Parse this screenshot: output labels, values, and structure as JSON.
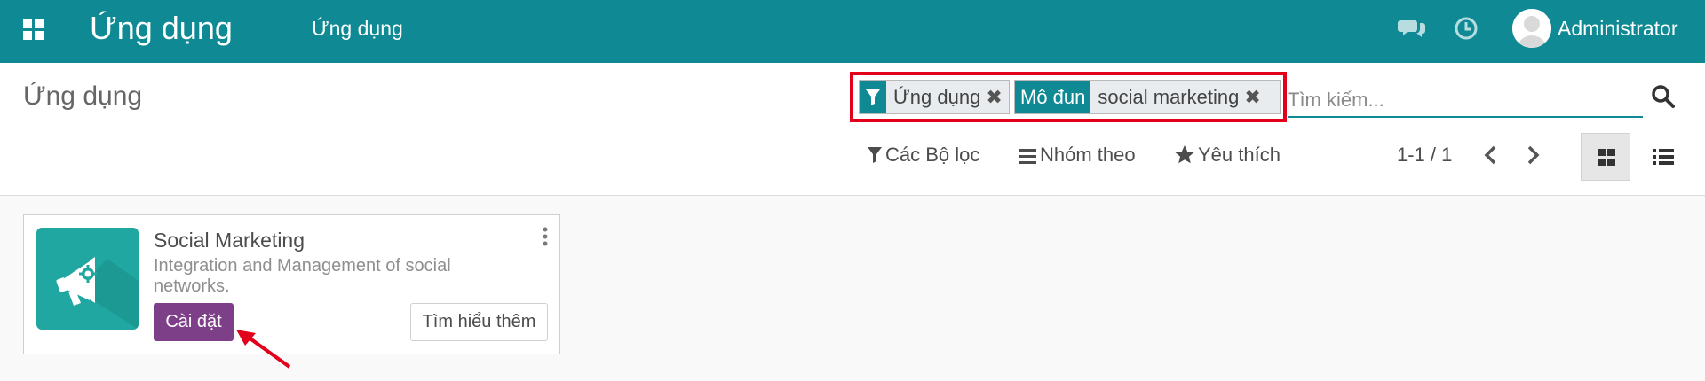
{
  "navbar": {
    "brand": "Ứng dụng",
    "menu_item": "Ứng dụng",
    "username": "Administrator",
    "color": "#0f8a94"
  },
  "control_panel": {
    "title": "Ứng dụng",
    "facets": [
      {
        "label_icon": "filter-icon",
        "value": "Ứng dụng"
      },
      {
        "label": "Mô đun",
        "value": "social marketing"
      }
    ],
    "search_placeholder": "Tìm kiếm...",
    "filters_label": "Các Bộ lọc",
    "group_by_label": "Nhóm theo",
    "favorites_label": "Yêu thích",
    "pager": "1-1 / 1"
  },
  "card": {
    "title": "Social Marketing",
    "description": "Integration and Management of social networks.",
    "install_label": "Cài đặt",
    "learn_more_label": "Tìm hiểu thêm",
    "install_color": "#7c3f88",
    "icon_name": "megaphone-icon"
  },
  "annotation": {
    "highlight_color": "#e2001a"
  }
}
